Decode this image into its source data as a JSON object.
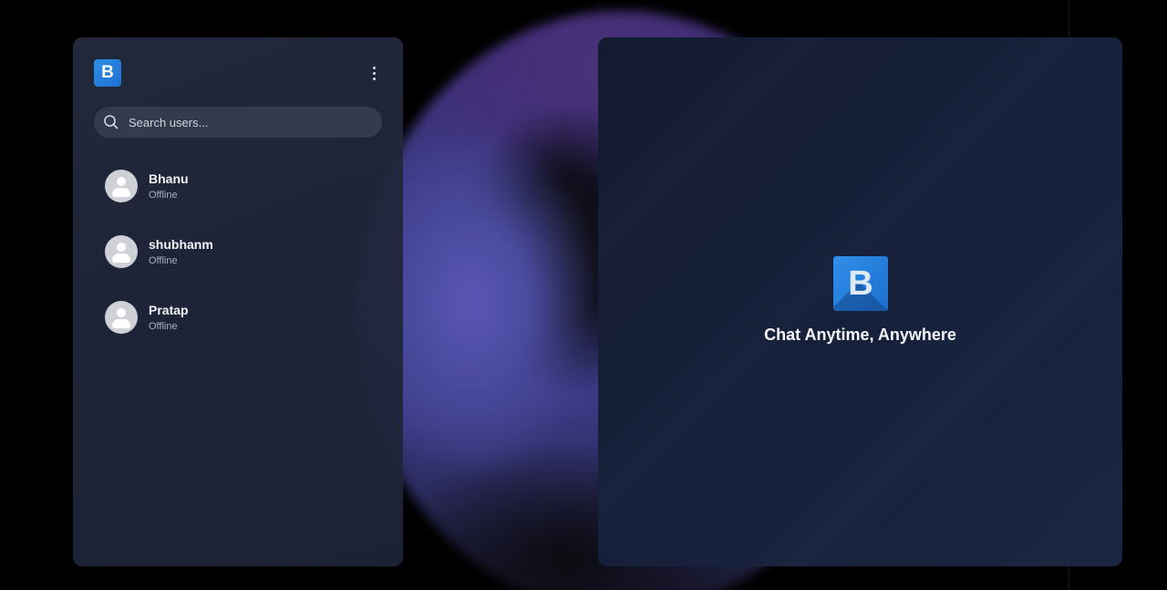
{
  "sidebar": {
    "logo_letter": "B",
    "search": {
      "placeholder": "Search users..."
    },
    "users": [
      {
        "name": "Bhanu",
        "status": "Offline"
      },
      {
        "name": "shubhanm",
        "status": "Offline"
      },
      {
        "name": "Pratap",
        "status": "Offline"
      }
    ]
  },
  "main": {
    "logo_letter": "B",
    "tagline": "Chat Anytime, Anywhere"
  },
  "colors": {
    "brand_blue": "#2d8fe6",
    "sidebar_bg": "#242a3e",
    "panel_bg": "#16203a",
    "search_bg": "#343b4e"
  },
  "icons": {
    "menu": "vertical-dots-icon",
    "search": "search-icon",
    "avatar": "user-avatar-icon"
  }
}
